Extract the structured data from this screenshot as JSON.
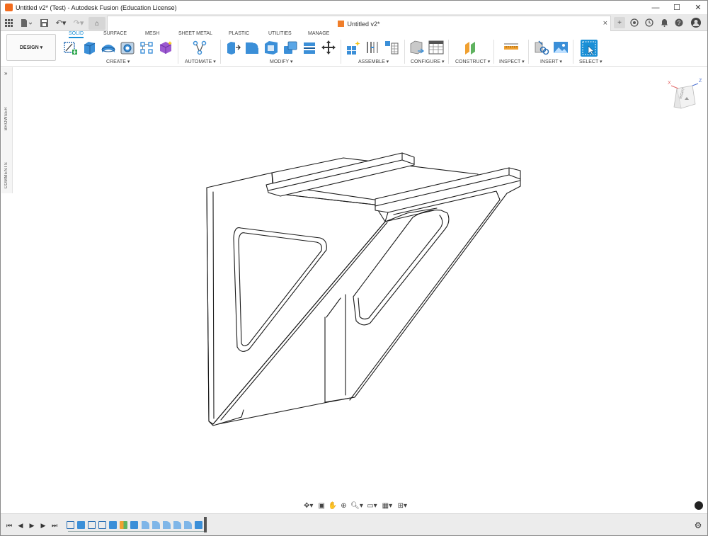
{
  "window": {
    "title": "Untitled v2* (Test) - Autodesk Fusion (Education License)",
    "controls": [
      "minimize",
      "maximize",
      "close"
    ]
  },
  "document_tab": {
    "label": "Untitled v2*",
    "close": "×"
  },
  "ribbon": {
    "workspace_label": "DESIGN ▾",
    "tabs": [
      "SOLID",
      "SURFACE",
      "MESH",
      "SHEET METAL",
      "PLASTIC",
      "UTILITIES",
      "MANAGE"
    ],
    "active_tab": "SOLID",
    "groups": [
      "CREATE ▾",
      "AUTOMATE ▾",
      "MODIFY ▾",
      "ASSEMBLE ▾",
      "CONFIGURE ▾",
      "CONSTRUCT ▾",
      "INSPECT ▾",
      "INSERT ▾",
      "SELECT ▾"
    ]
  },
  "left_panel": {
    "browser_label": "BROWSER",
    "comments_label": "COMMENTS"
  },
  "viewcube": {
    "face_label": "RIGHT",
    "axis_x": "X",
    "axis_z": "Z"
  },
  "colors": {
    "accent": "#1a8fd6",
    "brand": "#f26b1d",
    "model_line": "#1a1a1a"
  }
}
